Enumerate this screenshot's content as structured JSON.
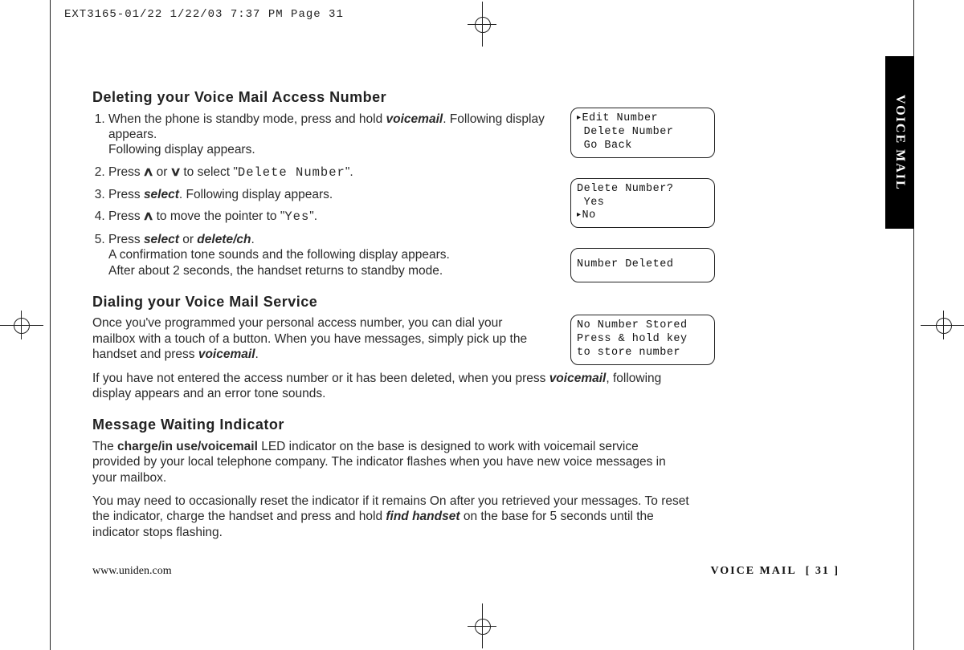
{
  "prepress_slug": "EXT3165-01/22  1/22/03  7:37 PM  Page 31",
  "side_tab": "VOICE MAIL",
  "section_delete": {
    "title": "Deleting your Voice Mail Access Number",
    "step1a": "When the phone is standby mode, press and hold ",
    "step1_key": "voicemail",
    "step1b": ". Following display appears.",
    "step2a": "Press ",
    "step2b": " or ",
    "step2c": " to select \"",
    "step2_lcd": "Delete Number",
    "step2d": "\".",
    "step3a": "Press ",
    "step3_key": "select",
    "step3b": ". Following display appears.",
    "step4a": "Press ",
    "step4b": " to move the pointer to \"",
    "step4_lcd": "Yes",
    "step4c": "\".",
    "step5a": "Press ",
    "step5_key1": "select",
    "step5_mid": " or ",
    "step5_key2": "delete/ch",
    "step5b": ".",
    "step5_line2": "A confirmation tone sounds and the following display appears.",
    "step5_line3": "After about 2 seconds, the handset returns to standby mode."
  },
  "section_dial": {
    "title": "Dialing your Voice Mail Service",
    "p1a": "Once you've programmed your personal access number, you can dial your mailbox with a touch of a button.  When you have messages, simply pick up the handset and press ",
    "p1_key": "voicemail",
    "p1b": ".",
    "p2a": "If you have not entered the access number or it has been deleted, when you press ",
    "p2_key": "voicemail",
    "p2b": ", following display appears and an error tone sounds."
  },
  "section_mwi": {
    "title": "Message Waiting Indicator",
    "p1a": "The ",
    "p1_bold": "charge/in use/voicemail",
    "p1b": " LED indicator on the base is designed to work with voicemail service provided by your local telephone company. The indicator flashes when you have new voice messages in your mailbox.",
    "p2a": "You may need to occasionally reset the indicator if it remains On after you retrieved your messages. To reset the indicator, charge the handset and press and hold ",
    "p2_key": "find handset",
    "p2b": " on the base for 5 seconds until the indicator stops flashing."
  },
  "lcd": {
    "l1a": "Edit Number",
    "l1b": " Delete Number",
    "l1c": " Go Back",
    "l2a": "Delete Number?",
    "l2b": " Yes",
    "l2c": "No",
    "l3": "Number Deleted",
    "l4a": "No Number Stored",
    "l4b": "Press & hold key",
    "l4c": "to store number"
  },
  "footer": {
    "url": "www.uniden.com",
    "label": "VOICE MAIL",
    "page": "[ 31 ]"
  }
}
